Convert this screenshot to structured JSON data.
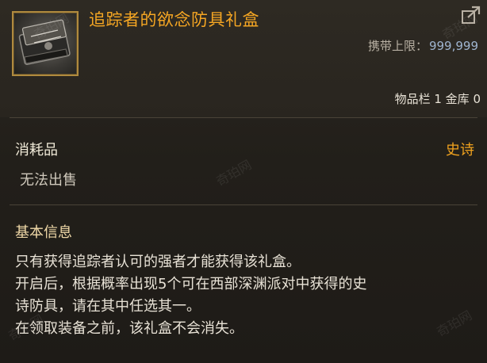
{
  "item": {
    "name": "追踪者的欲念防具礼盒",
    "carry_limit_label": "携带上限：",
    "carry_limit_value": "999,999",
    "inventory_info": "物品栏 1 金库 0"
  },
  "properties": {
    "category": "消耗品",
    "rarity": "史诗",
    "sell_status": "无法出售"
  },
  "info": {
    "title": "基本信息",
    "lines": [
      "只有获得追踪者认可的强者才能获得该礼盒。",
      "开启后，根据概率出现5个可在西部深渊派对中获得的史",
      "诗防具，请在其中任选其一。",
      "在领取装备之前，该礼盒不会消失。"
    ]
  },
  "watermark": "奇珀网",
  "colors": {
    "item_name": "#f5a623",
    "rarity_epic": "#f0a21e",
    "carry_value": "#9fb4cf"
  },
  "icons": {
    "item": "armor-gift-box-icon",
    "share": "share-arrow-icon"
  }
}
